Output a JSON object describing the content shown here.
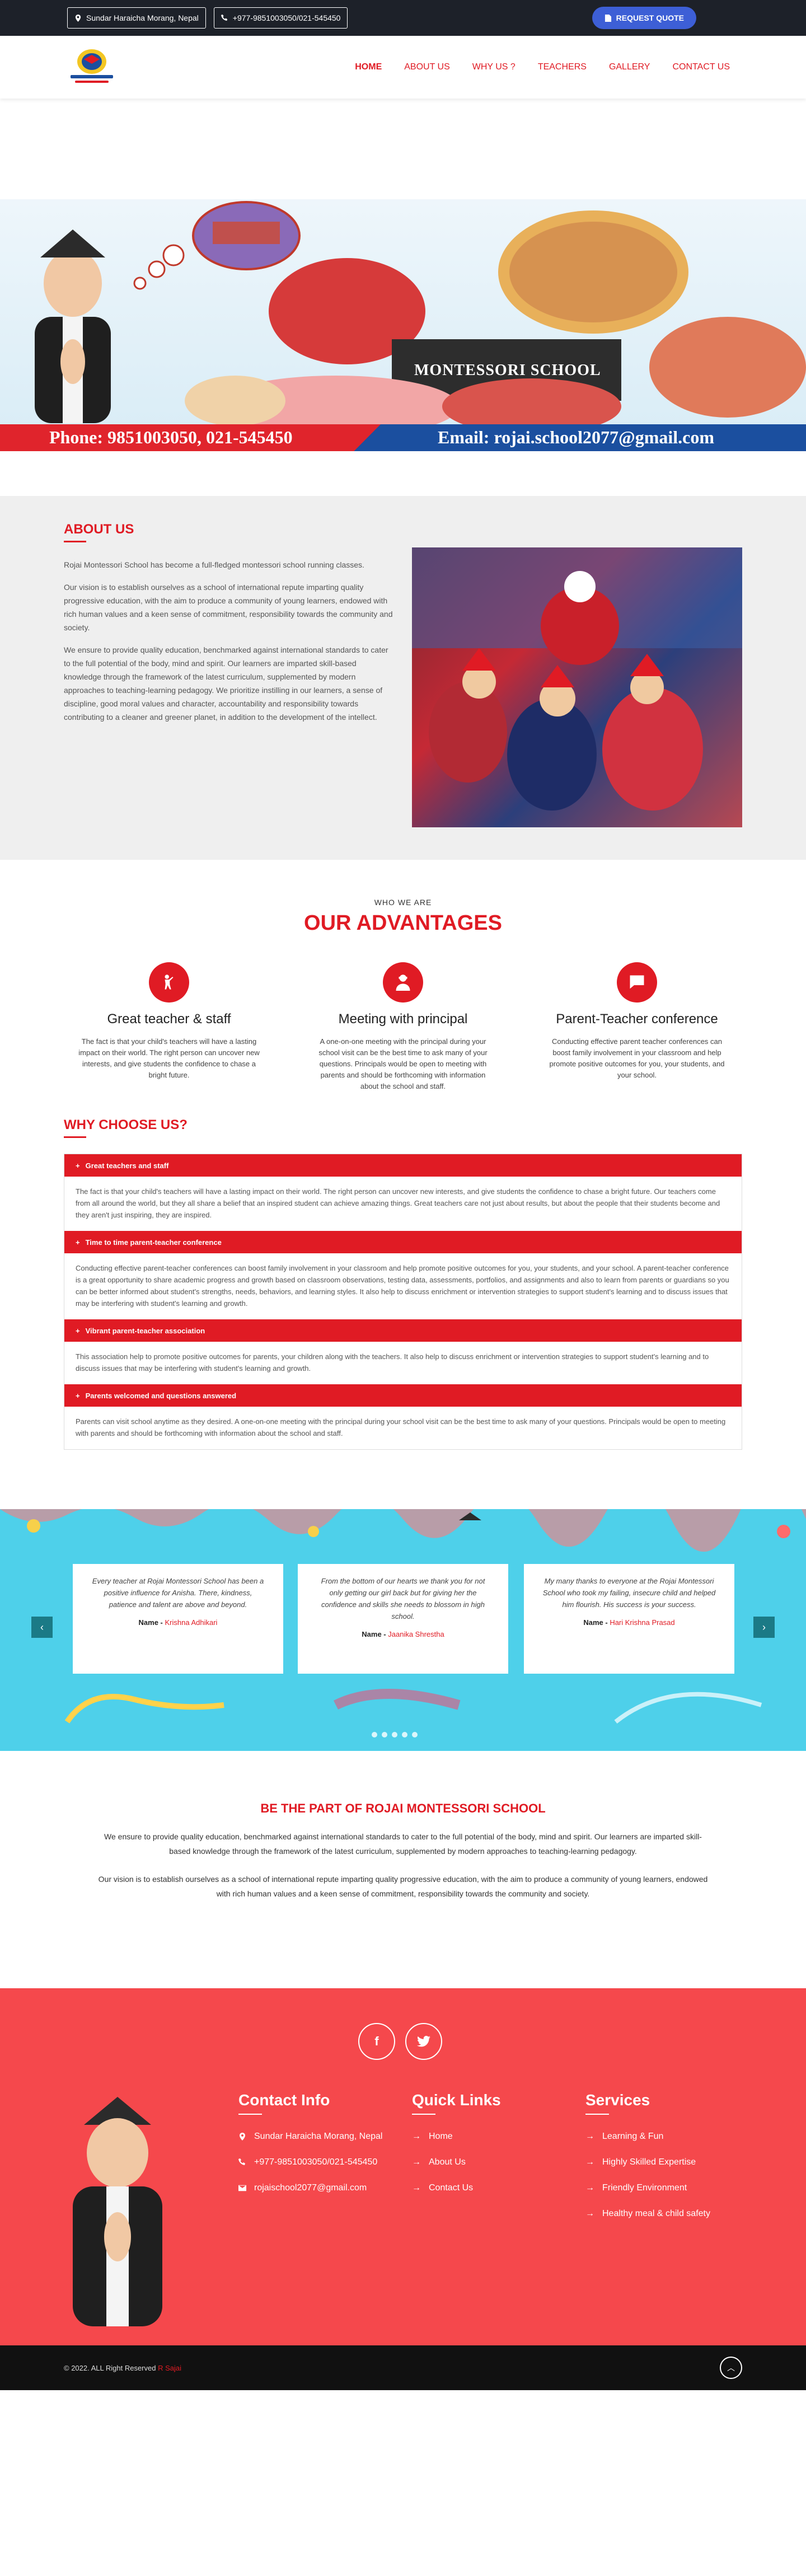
{
  "topbar": {
    "address": "Sundar Haraicha Morang, Nepal",
    "phone": "+977-9851003050/021-545450",
    "quote_label": "REQUEST QUOTE"
  },
  "nav": {
    "items": [
      {
        "label": "HOME"
      },
      {
        "label": "ABOUT US"
      },
      {
        "label": "WHY US ?"
      },
      {
        "label": "TEACHERS"
      },
      {
        "label": "GALLERY"
      },
      {
        "label": "CONTACT US"
      }
    ]
  },
  "banner": {
    "phone": "Phone: 9851003050, 021-545450",
    "email": "Email: rojai.school2077@gmail.com",
    "sign": "MONTESSORI SCHOOL"
  },
  "about": {
    "title": "ABOUT US",
    "paragraphs": [
      "Rojai Montessori School has become a full-fledged montessori school running classes.",
      "Our vision is to establish ourselves as a school of international repute imparting quality progressive education, with the aim to produce a community of young learners, endowed with rich human values and a keen sense of commitment, responsibility towards the community and society.",
      "We ensure to provide quality education, benchmarked against international standards to cater to the full potential of the body, mind and spirit. Our learners are imparted skill-based knowledge through the framework of the latest curriculum, supplemented by modern approaches to teaching-learning pedagogy. We prioritize instilling in our learners, a sense of discipline, good moral values and character, accountability and responsibility towards contributing to a cleaner and greener planet, in addition to the development of the intellect."
    ]
  },
  "advantages": {
    "pre": "WHO WE ARE",
    "title": "OUR ADVANTAGES",
    "cards": [
      {
        "icon": "teacher-icon",
        "title": "Great teacher & staff",
        "text": "The fact is that your child's teachers will have a lasting impact on their world. The right person can uncover new interests, and give students the confidence to chase a bright future."
      },
      {
        "icon": "principal-icon",
        "title": "Meeting with principal",
        "text": "A one-on-one meeting with the principal during your school visit can be the best time to ask many of your questions. Principals would be open to meeting with parents and should be forthcoming with information about the school and staff."
      },
      {
        "icon": "chat-icon",
        "title": "Parent-Teacher conference",
        "text": "Conducting effective parent teacher conferences can boost family involvement in your classroom and help promote positive outcomes for you, your students, and your school."
      }
    ]
  },
  "why": {
    "title": "WHY CHOOSE US?",
    "items": [
      {
        "title": "Great teachers and staff",
        "text": "The fact is that your child's teachers will have a lasting impact on their world. The right person can uncover new interests, and give students the confidence to chase a bright future. Our teachers come from all around the world, but they all share a belief that an inspired student can achieve amazing things. Great teachers care not just about results, but about the people that their students become and they aren't just inspiring, they are inspired."
      },
      {
        "title": "Time to time parent-teacher conference",
        "text": "Conducting effective parent-teacher conferences can boost family involvement in your classroom and help promote positive outcomes for you, your students, and your school. A parent-teacher conference is a great opportunity to share academic progress and growth based on classroom observations, testing data, assessments, portfolios, and assignments and also to learn from parents or guardians so you can be better informed about student's strengths, needs, behaviors, and learning styles. It also help to discuss enrichment or intervention strategies to support student's learning and to discuss issues that may be interfering with student's learning and growth."
      },
      {
        "title": "Vibrant parent-teacher association",
        "text": "This association help to promote positive outcomes for parents, your children along with the teachers. It also help to discuss enrichment or intervention strategies to support student's learning and to discuss issues that may be interfering with student's learning and growth."
      },
      {
        "title": "Parents welcomed and questions answered",
        "text": "Parents can visit school anytime as they desired. A one-on-one meeting with the principal during your school visit can be the best time to ask many of your questions. Principals would be open to meeting with parents and should be forthcoming with information about the school and staff."
      }
    ]
  },
  "testimonials": {
    "name_label": "Name - ",
    "items": [
      {
        "quote": "Every teacher at Rojai Montessori School has been a positive influence for Anisha. There, kindness, patience and talent are above and beyond.",
        "name": "Krishna Adhikari"
      },
      {
        "quote": "From the bottom of our hearts we thank you for not only getting our girl back but for giving her the confidence and skills she needs to blossom in high school.",
        "name": "Jaanika Shrestha"
      },
      {
        "quote": "My many thanks to everyone at the Rojai Montessori School who took my failing, insecure child and helped him flourish. His success is your success.",
        "name": "Hari Krishna Prasad"
      }
    ]
  },
  "part": {
    "title": "BE THE PART OF ROJAI MONTESSORI SCHOOL",
    "paragraphs": [
      "We ensure to provide quality education, benchmarked against international standards to cater to the full potential of the body, mind and spirit. Our learners are imparted skill-based knowledge through the framework of the latest curriculum, supplemented by modern approaches to teaching-learning pedagogy.",
      "Our vision is to establish ourselves as a school of international repute imparting quality progressive education, with the aim to produce a community of young learners, endowed with rich human values and a keen sense of commitment, responsibility towards the community and society."
    ]
  },
  "footer": {
    "contact_title": "Contact Info",
    "address": "Sundar Haraicha Morang, Nepal",
    "phone": "+977-9851003050/021-545450",
    "email": "rojaischool2077@gmail.com",
    "links_title": "Quick Links",
    "links": [
      "Home",
      "About Us",
      "Contact Us"
    ],
    "services_title": "Services",
    "services": [
      "Learning & Fun",
      "Highly Skilled Expertise",
      "Friendly Environment",
      "Healthy meal & child safety"
    ],
    "copyright": "© 2022. ALL Right Reserved",
    "brand": "R Sajai"
  },
  "colors": {
    "accent": "#e01b24",
    "dark": "#1d2129",
    "footer": "#f5484c",
    "testimonial_bg": "#4ed0ea"
  }
}
